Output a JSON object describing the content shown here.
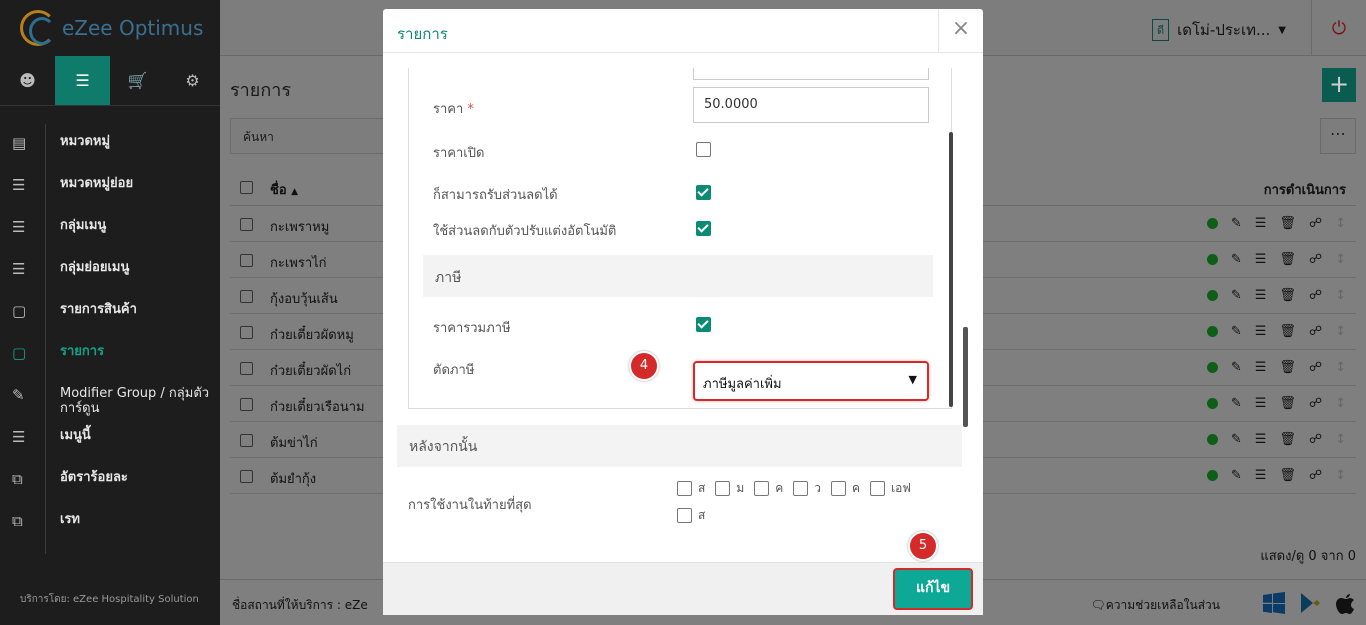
{
  "app": {
    "logo_text": "eZee Optimus",
    "footer": "บริการโดย: eZee Hospitality Solution"
  },
  "sidebar": {
    "items": [
      {
        "label": "หมวดหมู่",
        "icon": "list-icon"
      },
      {
        "label": "หมวดหมู่ย่อย",
        "icon": "sublist-icon"
      },
      {
        "label": "กลุ่มเมนู",
        "icon": "menu-lines-icon"
      },
      {
        "label": "กลุ่มย่อยเมนู",
        "icon": "submenu-icon"
      },
      {
        "label": "รายการสินค้า",
        "icon": "box-icon"
      },
      {
        "label": "รายการ",
        "icon": "cube-icon"
      },
      {
        "label": "Modifier Group / กลุ่มตัวการ์ดูน",
        "icon": "edit-icon"
      },
      {
        "label": "เมนูนี้",
        "icon": "hamburger-icon"
      },
      {
        "label": "อัตราร้อยละ",
        "icon": "copy-icon"
      },
      {
        "label": "เรท",
        "icon": "copy2-icon"
      }
    ]
  },
  "header": {
    "property_badge": "ดี",
    "property_name": "เดโม่-ประเท..."
  },
  "page": {
    "title": "รายการ",
    "search_placeholder": "ค้นหา",
    "col_name": "ชื่อ",
    "col_actions": "การดำเนินการ",
    "rows": [
      "กะเพราหมู",
      "กะเพราไก่",
      "กุ้งอบวุ้นเส้น",
      "ก๋วยเตี๋ยวผัดหมู",
      "ก๋วยเตี๋ยวผัดไก่",
      "ก๋วยเตี๋ยวเรือนาม",
      "ต้มข่าไก่",
      "ต้มยำกุ้ง"
    ],
    "pager": "แสดง/ดู 0 จาก 0",
    "provider": "ชื่อสถานที่ให้บริการ : eZe",
    "help": "ความช่วยเหลือในส่วน"
  },
  "modal": {
    "title": "รายการ",
    "price_label": "ราคา",
    "price_req": "*",
    "price_value": "50.0000",
    "open_price_label": "ราคาเปิด",
    "open_price_checked": false,
    "discount_label": "ก็สามารถรับส่วนลดได้",
    "discount_checked": true,
    "auto_discount_label": "ใช้ส่วนลดกับตัวปรับแต่งอัตโนมัติ",
    "auto_discount_checked": true,
    "tax_section": "ภาษี",
    "tax_incl_label": "ราคารวมภาษี",
    "tax_incl_checked": true,
    "tax_cut_label": "ตัดภาษี",
    "tax_cut_value": "ภาษีมูลค่าเพิ่ม",
    "step4": "4",
    "after_section": "หลังจากนั้น",
    "last_used_label": "การใช้งานในท้ายที่สุด",
    "days": [
      "ส",
      "ม",
      "ค",
      "ว",
      "ค",
      "เอฟ",
      "ส"
    ],
    "edit_button": "แก้ไข",
    "step5": "5"
  }
}
